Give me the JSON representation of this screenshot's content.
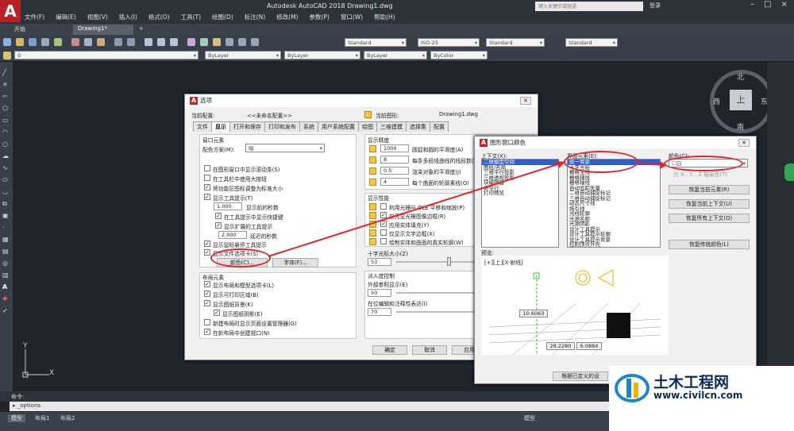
{
  "app": {
    "title": "Autodesk AutoCAD 2018    Drawing1.dwg",
    "logo": "A",
    "search_placeholder": "键入关键字或短语",
    "login": "登录"
  },
  "menu": [
    "文件(F)",
    "编辑(E)",
    "视图(V)",
    "插入(I)",
    "格式(O)",
    "工具(T)",
    "绘图(D)",
    "标注(N)",
    "修改(M)",
    "参数(P)",
    "窗口(W)",
    "帮助(H)"
  ],
  "tabs": {
    "start": "开始",
    "drawing": "Drawing1*",
    "plus": "+"
  },
  "toolbar": {
    "text_style": "Standard",
    "dim_style": "ISO-25",
    "table_style": "Standard",
    "ml_style": "Standard",
    "layer": "0",
    "color": "ByLayer",
    "linetype": "ByLayer",
    "lineweight": "ByLayer",
    "plotstyle": "ByColor"
  },
  "compass": {
    "n": "北",
    "s": "南",
    "e": "东",
    "w": "西",
    "face": "上"
  },
  "ucs": {
    "x": "X",
    "y": "Y"
  },
  "command": {
    "label": "命令:",
    "input": "_options"
  },
  "status": {
    "model": "模型",
    "layout1": "布局1",
    "layout2": "布局2",
    "model_right": "模型"
  },
  "options": {
    "title": "选项",
    "current_profile_label": "当前配置:",
    "current_profile": "<<未命名配置>>",
    "current_drawing_label": "当前图形:",
    "current_drawing": "Drawing1.dwg",
    "tabs": [
      "文件",
      "显示",
      "打开和保存",
      "打印和发布",
      "系统",
      "用户系统配置",
      "绘图",
      "三维建模",
      "选择集",
      "配置"
    ],
    "window_elements": {
      "title": "窗口元素",
      "scheme_label": "配色方案(M):",
      "scheme": "暗",
      "scroll": "在图形窗口中显示滚动条(S)",
      "big_buttons": "在工具栏中使用大按钮",
      "resize_icons": "将功能区图标调整为标准大小",
      "tooltips": "显示工具提示(T)",
      "delay1": "1.000",
      "delay1_label": "显示前的秒数",
      "shortcut": "在工具提示中显示快捷键",
      "ext_tips": "显示扩展的工具提示",
      "delay2": "2.000",
      "delay2_label": "延迟的秒数",
      "rollover": "显示鼠标悬停工具提示",
      "file_tabs": "显示文件选项卡(S)",
      "colors_btn": "颜色(C)...",
      "fonts_btn": "字体(F)..."
    },
    "layout_elements": {
      "title": "布局元素",
      "layout_tabs": "显示布局和模型选项卡(L)",
      "printable": "显示可打印区域(B)",
      "paper_bg": "显示图纸背景(K)",
      "paper_shadow": "显示图纸阴影(E)",
      "page_setup": "新建布局时显示页面设置管理器(G)",
      "create_vp": "在新布局中创建视口(N)"
    },
    "resolution": {
      "title": "显示精度",
      "arc": "1000",
      "arc_label": "圆弧和圆的平滑度(A)",
      "poly": "8",
      "poly_label": "每条多段线曲线的线段数(V)",
      "render": "0.5",
      "render_label": "渲染对象的平滑度(J)",
      "contour": "4",
      "contour_label": "每个曲面的轮廓素线(O)"
    },
    "performance": {
      "title": "显示性能",
      "ole": "利用光栅与 OLE 平移和缩放(P)",
      "highlight": "仅亮显光栅图像边框(R)",
      "fill": "应用实体填充(Y)",
      "text_frame": "仅显示文字边框(X)",
      "silhouette": "绘制实体和曲面的真实轮廓(W)"
    },
    "crosshair": {
      "title": "十字光标大小(Z)",
      "value": "53"
    },
    "fade": {
      "title": "淡入度控制",
      "xref": "外部参照显示(E)",
      "xref_val": "50",
      "inplace": "在位编辑和注释性表达(I)",
      "inplace_val": "70"
    },
    "buttons": {
      "ok": "确定",
      "cancel": "取消",
      "apply": "应用"
    }
  },
  "color_dialog": {
    "title": "图形窗口颜色",
    "context_label": "上下文(X):",
    "contexts": [
      "二维模型空间",
      "图纸/布局",
      "三维平行投影",
      "三维透视投影",
      "块编辑器",
      "命令行",
      "打印预览"
    ],
    "element_label": "界面元素(E):",
    "elements": [
      "统一背景",
      "十字光标",
      "栅格主线",
      "栅格辅线",
      "栅格轴线",
      "自动追踪矢量",
      "二维自动捕捉标记",
      "三维自动捕捉标记",
      "动态尺寸线",
      "拖引线",
      "光线轮廓",
      "光源名称",
      "光源阴影",
      "设计工具提示",
      "设计工具提示轮廓",
      "设计工具提示背景",
      "控制顶点外壳"
    ],
    "color_label": "颜色(C):",
    "color_value": "白",
    "tint": "为 X、Y、Z 轴染色(T)",
    "restore_current": "恢复当前元素(R)",
    "restore_context": "恢复当前上下文(U)",
    "restore_all": "恢复所有上下文(O)",
    "restore_classic": "恢复传统颜色(L)",
    "preview_label": "预览:",
    "viewport_label": "[+][上][X-射线]",
    "dim1": "10.6063",
    "dim2": "28.2280",
    "dim3": "6.0884",
    "footer": "根据已定义的设"
  },
  "watermark": {
    "title": "土木工程网",
    "url": "www.civilcn.com"
  },
  "colors": {
    "annotation_red": "#e0262c",
    "selection": "#3060d0",
    "brand": "#b8202a"
  }
}
